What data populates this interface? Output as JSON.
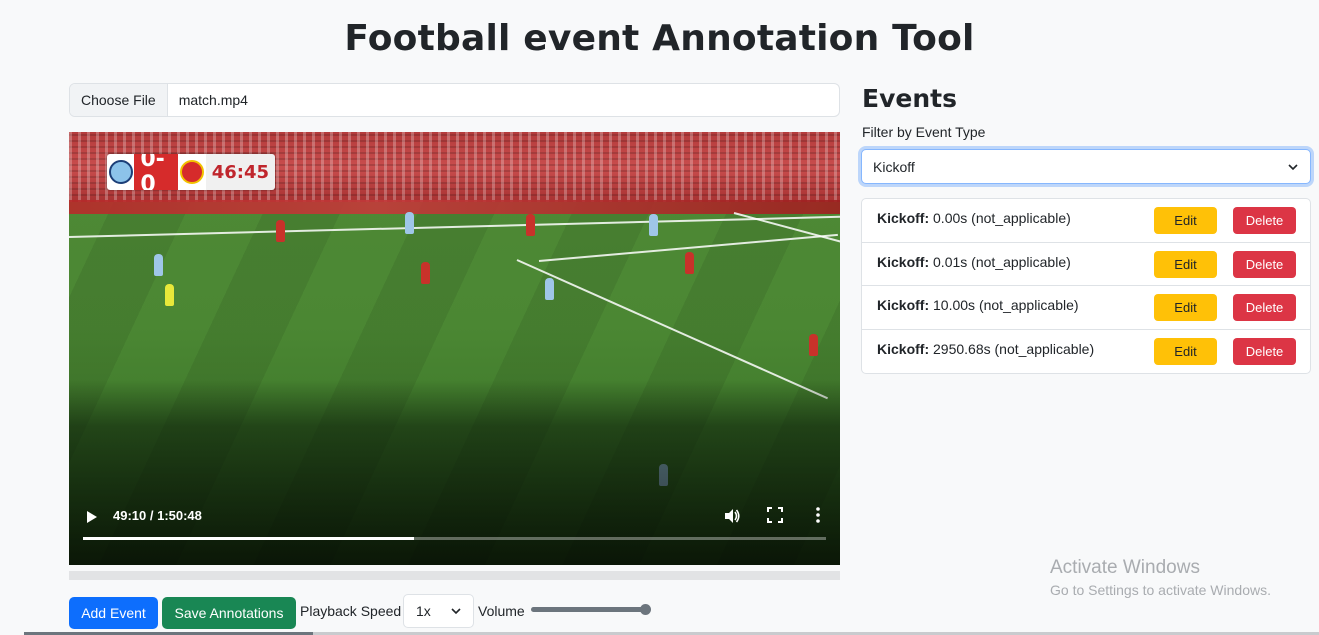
{
  "page": {
    "title": "Football event Annotation Tool"
  },
  "file": {
    "button_label": "Choose File",
    "file_name": "match.mp4"
  },
  "video": {
    "scorebug": {
      "score": "0-0",
      "clock": "46:45"
    },
    "time_display": "49:10 / 1:50:48",
    "progress_fraction": 0.445,
    "icons": {
      "play": "play-icon",
      "volume": "volume-icon",
      "fullscreen": "fullscreen-icon",
      "more": "more-vertical-icon"
    }
  },
  "controls": {
    "add_event_label": "Add Event",
    "save_label": "Save Annotations",
    "speed_label": "Playback Speed",
    "speed_value": "1x",
    "volume_label": "Volume",
    "volume_fraction": 1.0
  },
  "events": {
    "heading": "Events",
    "filter_label": "Filter by Event Type",
    "filter_value": "Kickoff",
    "items": [
      {
        "type": "Kickoff:",
        "detail": " 0.00s (not_applicable)",
        "edit": "Edit",
        "delete": "Delete"
      },
      {
        "type": "Kickoff:",
        "detail": " 0.01s (not_applicable)",
        "edit": "Edit",
        "delete": "Delete"
      },
      {
        "type": "Kickoff:",
        "detail": " 10.00s (not_applicable)",
        "edit": "Edit",
        "delete": "Delete"
      },
      {
        "type": "Kickoff:",
        "detail": " 2950.68s (not_applicable)",
        "edit": "Edit",
        "delete": "Delete"
      }
    ]
  },
  "watermark": {
    "line1": "Activate Windows",
    "line2": "Go to Settings to activate Windows."
  },
  "colors": {
    "primary": "#0d6efd",
    "success": "#198754",
    "warning": "#ffc107",
    "danger": "#dc3545"
  }
}
